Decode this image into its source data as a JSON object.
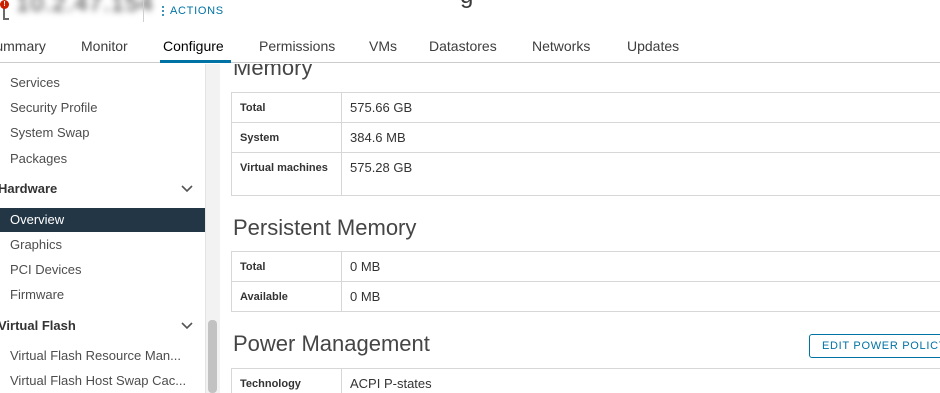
{
  "header": {
    "host_name": "10.2.47.154",
    "title_partial": "g",
    "actions_label": "ACTIONS",
    "colors": {
      "accent": "#0072a3",
      "alert": "#c92100"
    }
  },
  "tabs": [
    {
      "label": "Summary"
    },
    {
      "label": "Monitor"
    },
    {
      "label": "Configure",
      "active": true
    },
    {
      "label": "Permissions"
    },
    {
      "label": "VMs"
    },
    {
      "label": "Datastores"
    },
    {
      "label": "Networks"
    },
    {
      "label": "Updates"
    }
  ],
  "sidebar": {
    "items_top": [
      {
        "label": "Services"
      },
      {
        "label": "Security Profile"
      },
      {
        "label": "System Swap"
      },
      {
        "label": "Packages"
      }
    ],
    "group_hardware": "Hardware",
    "hardware_items": [
      {
        "label": "Overview",
        "active": true
      },
      {
        "label": "Graphics"
      },
      {
        "label": "PCI Devices"
      },
      {
        "label": "Firmware"
      }
    ],
    "group_flash": "Virtual Flash",
    "flash_items": [
      {
        "label": "Virtual Flash Resource Man..."
      },
      {
        "label": "Virtual Flash Host Swap Cac..."
      }
    ],
    "colors": {
      "active_bg": "#233646"
    }
  },
  "memory": {
    "title": "Memory",
    "rows": [
      {
        "key": "Total",
        "value": "575.66 GB"
      },
      {
        "key": "System",
        "value": "384.6 MB"
      },
      {
        "key": "Virtual machines",
        "value": "575.28 GB"
      }
    ]
  },
  "persistent_memory": {
    "title": "Persistent Memory",
    "rows": [
      {
        "key": "Total",
        "value": "0 MB"
      },
      {
        "key": "Available",
        "value": "0 MB"
      }
    ]
  },
  "power_management": {
    "title": "Power Management",
    "edit_button": "EDIT POWER POLICY",
    "rows": [
      {
        "key": "Technology",
        "value": "ACPI P-states"
      }
    ]
  }
}
